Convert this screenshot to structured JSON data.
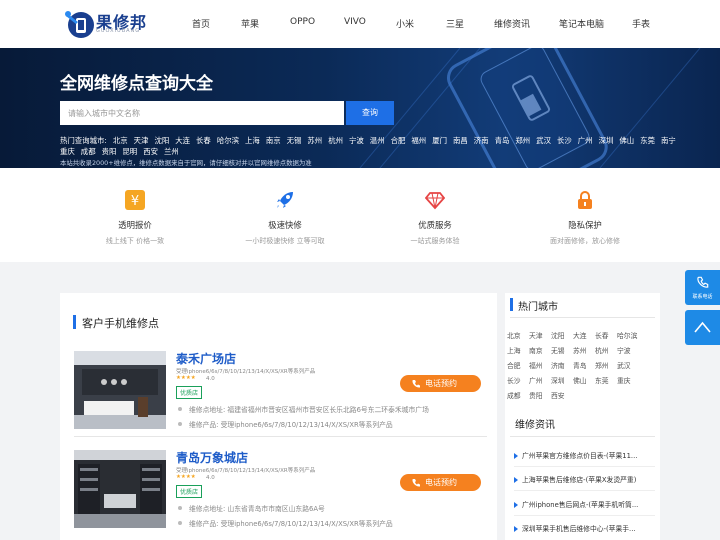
{
  "brand": {
    "name": "果修邦",
    "sub": "GUOXIUBANG"
  },
  "nav": [
    "首页",
    "苹果",
    "OPPO",
    "VIVO",
    "小米",
    "三星",
    "维修资讯",
    "笔记本电脑",
    "手表"
  ],
  "hero": {
    "title": "全网维修点查询大全",
    "search_placeholder": "请输入城市中文名称",
    "search_button": "查询",
    "hot_label": "热门查询城市:",
    "cities_row1": [
      "北京",
      "天津",
      "沈阳",
      "大连",
      "长春",
      "哈尔滨",
      "上海",
      "南京",
      "无锡",
      "苏州",
      "杭州",
      "宁波",
      "温州",
      "合肥",
      "福州",
      "厦门",
      "南昌",
      "济南",
      "青岛",
      "郑州",
      "武汉",
      "长沙",
      "广州",
      "深圳",
      "佛山",
      "东莞",
      "南宁"
    ],
    "cities_row2": [
      "重庆",
      "成都",
      "贵阳",
      "昆明",
      "西安",
      "兰州"
    ],
    "note": "本站共收录2000+维修点，维修点数据来自于官网，请仔细核对并以官网维修点数据为准"
  },
  "features": [
    {
      "icon": "yen-icon",
      "title": "透明报价",
      "sub": "线上线下 价格一致",
      "color": "#f5a623"
    },
    {
      "icon": "rocket-icon",
      "title": "极速快修",
      "sub": "一小时极速快修 立等可取",
      "color": "#1e6fe6"
    },
    {
      "icon": "diamond-icon",
      "title": "优质服务",
      "sub": "一站式服务体验",
      "color": "#e64545"
    },
    {
      "icon": "lock-icon",
      "title": "隐私保护",
      "sub": "面对面修修，放心修修",
      "color": "#f5811f"
    }
  ],
  "section_title": "客户手机维修点",
  "shops": [
    {
      "name": "泰禾广场店",
      "desc": "受理iphone6/6s/7/8/10/12/13/14/X/XS/XR等系列产品",
      "stars": "★★★★",
      "rating": "4.0",
      "badge": "优质店",
      "address": "维修点地址:   福建省福州市晋安区福州市晋安区长乐北路6号东二环泰禾城市广场",
      "products": "维修产品:   受理iphone6/6s/7/8/10/12/13/14/X/XS/XR等系列产品",
      "call": "电话预约"
    },
    {
      "name": "青岛万象城店",
      "desc": "受理iphone6/6s/7/8/10/12/13/14/X/XS/XR等系列产品",
      "stars": "★★★★",
      "rating": "4.0",
      "badge": "优质店",
      "address": "维修点地址:   山东省青岛市市南区山东路6A号",
      "products": "维修产品:   受理iphone6/6s/7/8/10/12/13/14/X/XS/XR等系列产品",
      "call": "电话预约"
    }
  ],
  "hot_cities_title": "热门城市",
  "hot_cities": [
    "北京",
    "天津",
    "沈阳",
    "大连",
    "长春",
    "哈尔滨",
    "上海",
    "南京",
    "无锡",
    "苏州",
    "杭州",
    "宁波",
    "合肥",
    "福州",
    "济南",
    "青岛",
    "郑州",
    "武汉",
    "长沙",
    "广州",
    "深圳",
    "佛山",
    "东莞",
    "重庆",
    "成都",
    "贵阳",
    "西安"
  ],
  "news_title": "维修资讯",
  "news": [
    "广州苹果官方维修点价目表-(苹果11...",
    "上海苹果售后维修店-(苹果X发烫严重)",
    "广州iphone售后网点-(苹果手机听筒...",
    "深圳苹果手机售后维修中心-(苹果手..."
  ],
  "float": {
    "contact_label": "联系电话"
  }
}
